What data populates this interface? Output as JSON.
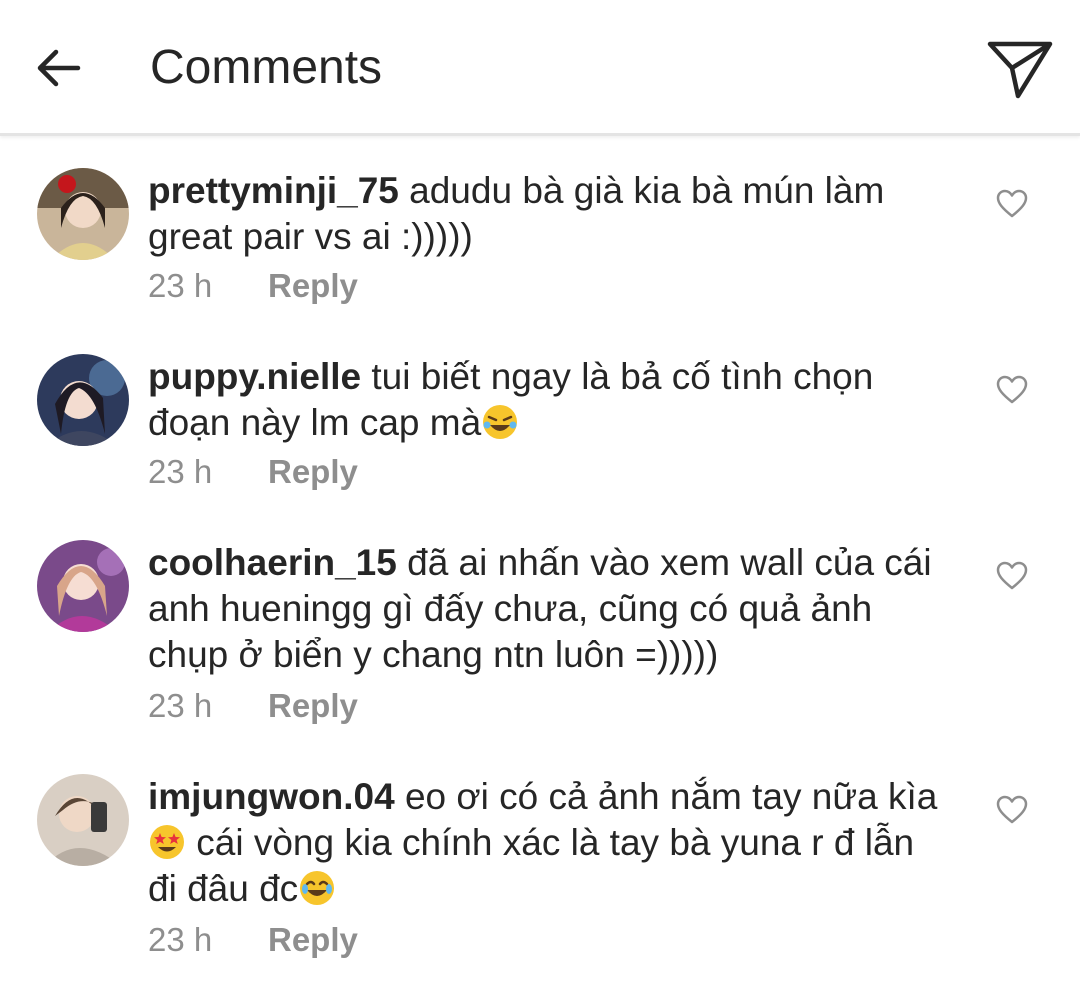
{
  "header": {
    "title": "Comments",
    "back_icon": "arrow-left-icon",
    "share_icon": "paper-plane-icon"
  },
  "colors": {
    "text": "#262626",
    "secondary": "#8e8e8e",
    "divider": "#e4e4e4"
  },
  "comments": [
    {
      "username": "prettyminji_75",
      "text": "adudu bà già kia bà mún làm great pair vs ai :)))))",
      "time": "23 h",
      "reply_label": "Reply",
      "emojis": []
    },
    {
      "username": "puppy.nielle",
      "text": "tui biết ngay là bả cố tình chọn đoạn này lm cap mà",
      "time": "23 h",
      "reply_label": "Reply",
      "emojis": [
        "rolling-on-floor-laughing-emoji"
      ]
    },
    {
      "username": "coolhaerin_15",
      "text": "đã ai nhấn vào xem wall của cái anh hueningg gì đấy chưa, cũng có quả ảnh chụp ở biển y chang ntn luôn =)))))",
      "time": "23 h",
      "reply_label": "Reply",
      "emojis": []
    },
    {
      "username": "imjungwon.04",
      "text_part1": "eo ơi có cả ảnh nắm tay nữa kìa",
      "text_part2": " cái vòng kia chính xác là tay bà yuna r đ lẫn đi đâu đc",
      "time": "23 h",
      "reply_label": "Reply",
      "emojis": [
        "star-struck-emoji",
        "tears-of-joy-emoji"
      ]
    }
  ]
}
